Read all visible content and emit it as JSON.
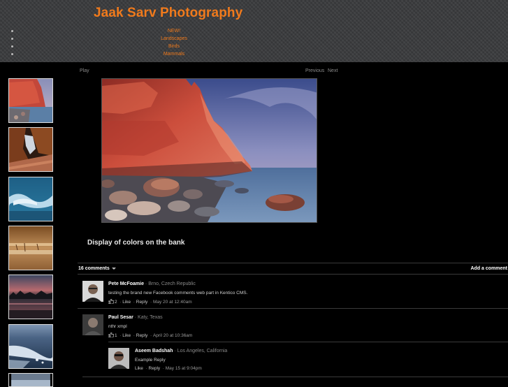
{
  "site": {
    "title": "Jaak Sarv Photography"
  },
  "nav": {
    "items": [
      "NEW!",
      "Landscapes",
      "Birds",
      "Mammals"
    ]
  },
  "gallery": {
    "play_label": "Play",
    "previous_label": "Previous",
    "next_label": "Next",
    "caption": "Display of colors on the bank"
  },
  "comments": {
    "count_label": "16 comments",
    "add_label": "Add a comment",
    "items": [
      {
        "name": "Pete McFoamie",
        "location": "Brno, Czech Republic",
        "text": "testing the brand new Facebook comments web part in Kentico CMS.",
        "likes": "2",
        "like_label": "Like",
        "reply_label": "Reply",
        "time": "May 20 at 12:40am"
      },
      {
        "name": "Paul Sesar",
        "location": "Katy, Texas",
        "text": "nthr xmpl",
        "likes": "1",
        "like_label": "Like",
        "reply_label": "Reply",
        "time": "April 20 at 10:36am"
      },
      {
        "name": "Aseem Badshah",
        "location": "Los Angeles, California",
        "text": "Example Reply",
        "like_label": "Like",
        "reply_label": "Reply",
        "time": "May 15 at 9:04pm"
      }
    ]
  },
  "colors": {
    "title": "#f07a1c",
    "nav_link": "#f07a1c",
    "header_bg": "#3a3b3d",
    "page_bg": "#000000"
  },
  "icons": {
    "like": "thumbs-up-icon",
    "caret": "caret-down-icon"
  }
}
